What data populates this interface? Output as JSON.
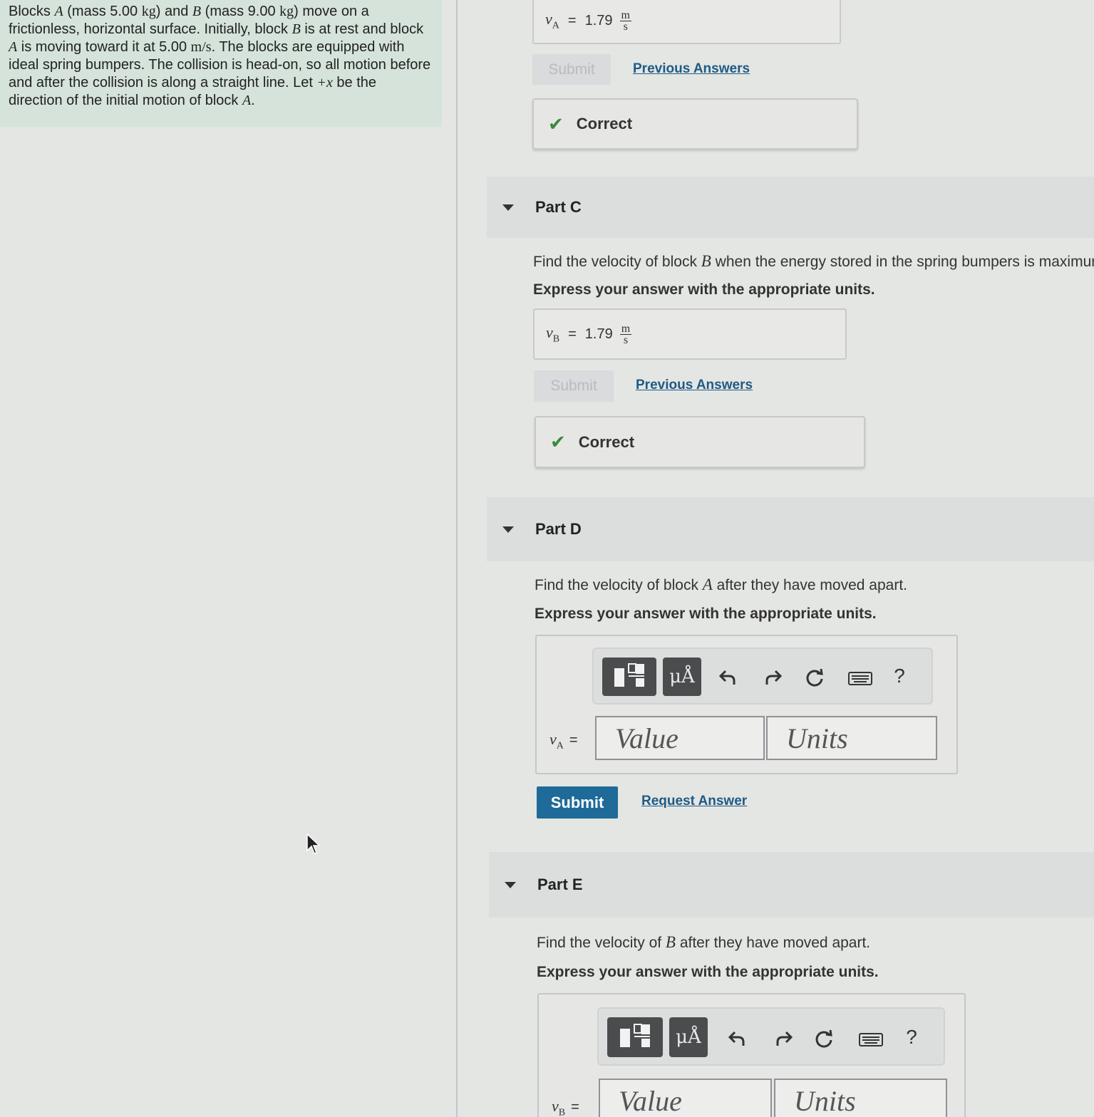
{
  "problem": {
    "t1": "Blocks ",
    "varA": "A",
    "t2": " (mass 5.00 ",
    "unit_kg": "kg",
    "t3": ") and ",
    "varB": "B",
    "t4": " (mass 9.00 ",
    "t5": ") move on a frictionless, horizontal surface. Initially, block ",
    "t6": " is at rest and block ",
    "t7": " is moving toward it at 5.00 ",
    "unit_ms": "m/s",
    "t8": ". The blocks are equipped with ideal spring bumpers. The collision is head-on, so all motion before and after the collision is along a straight line. Let ",
    "plus_x": "+x",
    "t9": " be the direction of the initial motion of block ",
    "t10": "."
  },
  "part_b": {
    "answer_var": "v",
    "answer_sub": "A",
    "answer_value": "1.79",
    "unit_num": "m",
    "unit_den": "s",
    "submit_label": "Submit",
    "previous_label": "Previous Answers",
    "feedback": "Correct"
  },
  "part_c": {
    "title": "Part C",
    "question_pre": "Find the velocity of block ",
    "question_var": "B",
    "question_post": " when the energy stored in the spring bumpers is maximum",
    "instruction": "Express your answer with the appropriate units.",
    "answer_var": "v",
    "answer_sub": "B",
    "answer_value": "1.79",
    "unit_num": "m",
    "unit_den": "s",
    "submit_label": "Submit",
    "previous_label": "Previous Answers",
    "feedback": "Correct"
  },
  "part_d": {
    "title": "Part D",
    "question_pre": "Find the velocity of block ",
    "question_var": "A",
    "question_post": " after they have moved apart.",
    "instruction": "Express your answer with the appropriate units.",
    "field_var": "v",
    "field_sub": "A",
    "value_placeholder": "Value",
    "units_placeholder": "Units",
    "submit_label": "Submit",
    "request_label": "Request Answer"
  },
  "part_e": {
    "title": "Part E",
    "question_pre": "Find the velocity of ",
    "question_var": "B",
    "question_post": " after they have moved apart.",
    "instruction": "Express your answer with the appropriate units.",
    "field_var": "v",
    "field_sub": "B",
    "value_placeholder": "Value",
    "units_placeholder": "Units"
  },
  "toolbar": {
    "units_glyph": "μÅ",
    "help_glyph": "?",
    "undo_icon": "undo-icon",
    "redo_icon": "redo-icon",
    "reset_icon": "reset-icon",
    "keyboard_icon": "keyboard-icon",
    "templates_icon": "templates-icon"
  },
  "colors": {
    "problem_bg": "#d5e3db",
    "link": "#1f5a86",
    "submit_bg": "#1e6a98",
    "check": "#3b8a3e"
  }
}
